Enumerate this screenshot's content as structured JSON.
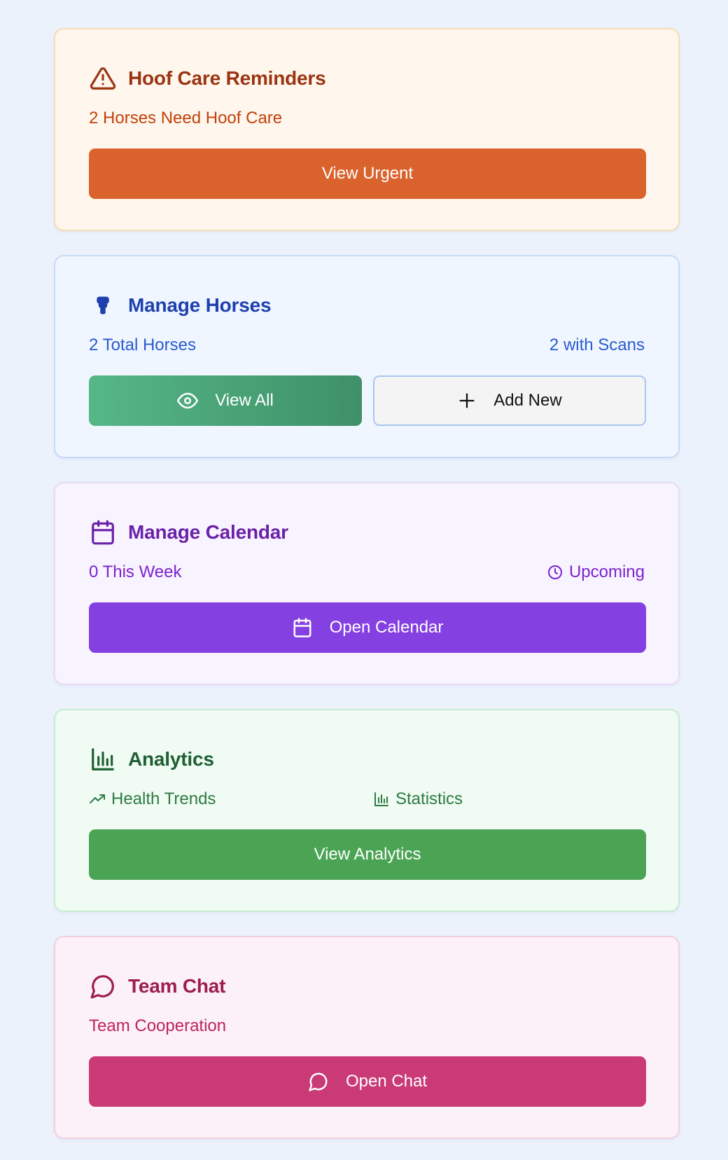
{
  "hoof_care": {
    "title": "Hoof Care Reminders",
    "subtitle": "2 Horses Need Hoof Care",
    "button_label": "View Urgent",
    "icon": "warning-triangle-icon",
    "accent_color": "#da622c"
  },
  "horses": {
    "title": "Manage Horses",
    "total_text": "2 Total Horses",
    "scans_text": "2 with Scans",
    "view_all_label": "View All",
    "add_new_label": "Add New",
    "icon": "horse-icon",
    "accent_color": "#1e40af"
  },
  "calendar": {
    "title": "Manage Calendar",
    "week_text": "0 This Week",
    "upcoming_text": "Upcoming",
    "button_label": "Open Calendar",
    "icon": "calendar-icon",
    "accent_color": "#8540e2"
  },
  "analytics": {
    "title": "Analytics",
    "trends_text": "Health Trends",
    "statistics_text": "Statistics",
    "button_label": "View Analytics",
    "icon": "bar-chart-icon",
    "accent_color": "#4ba354"
  },
  "team_chat": {
    "title": "Team Chat",
    "subtitle": "Team Cooperation",
    "button_label": "Open Chat",
    "icon": "chat-bubble-icon",
    "accent_color": "#c93a76"
  }
}
